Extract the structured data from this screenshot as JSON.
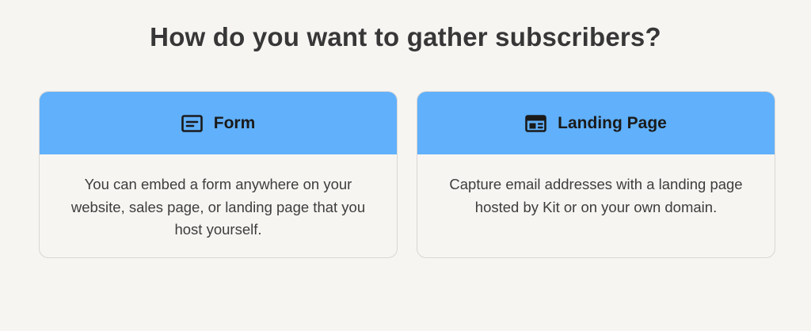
{
  "page": {
    "title": "How do you want to gather subscribers?"
  },
  "options": [
    {
      "title": "Form",
      "icon": "form-icon",
      "description": "You can embed a form anywhere on your website, sales page, or landing page that you host yourself."
    },
    {
      "title": "Landing Page",
      "icon": "landing-page-icon",
      "description": "Capture email addresses with a landing page hosted by Kit or on your own domain."
    }
  ],
  "colors": {
    "header_blue": "#60b0fb",
    "background": "#f7f5f2",
    "text_dark": "#373737"
  }
}
